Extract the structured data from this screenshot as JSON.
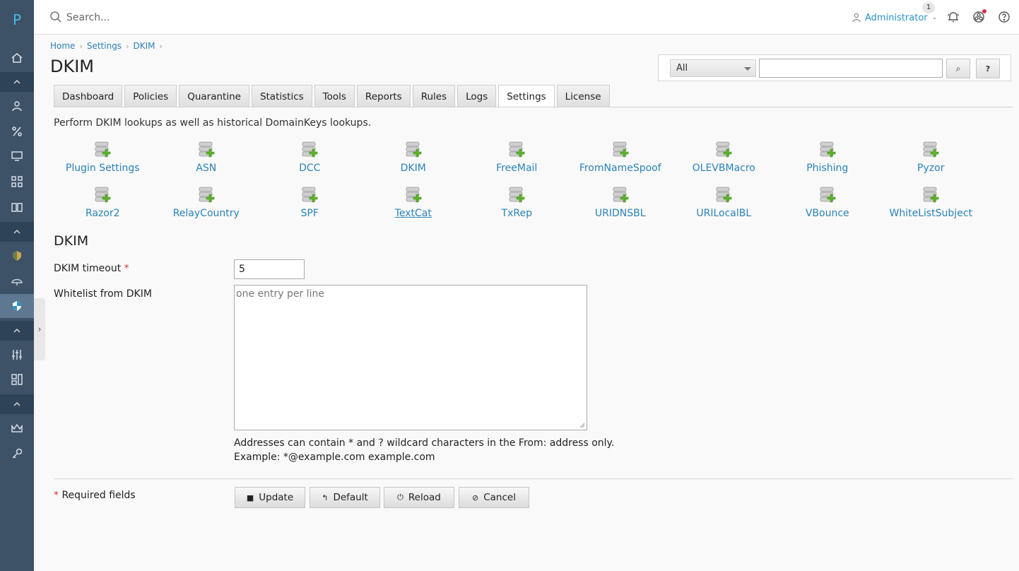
{
  "rail": {
    "logo": "P"
  },
  "topbar": {
    "search_placeholder": "Search...",
    "user_label": "Administrator",
    "notification_count": "1"
  },
  "breadcrumb": [
    "Home",
    "Settings",
    "DKIM"
  ],
  "page_title": "DKIM",
  "filter": {
    "select_value": "All",
    "search_icon_label": "⌕",
    "help_label": "?"
  },
  "tabs": [
    "Dashboard",
    "Policies",
    "Quarantine",
    "Statistics",
    "Tools",
    "Reports",
    "Rules",
    "Logs",
    "Settings",
    "License"
  ],
  "active_tab": "Settings",
  "description": "Perform DKIM lookups as well as historical DomainKeys lookups.",
  "plugins": [
    "Plugin Settings",
    "ASN",
    "DCC",
    "DKIM",
    "FreeMail",
    "FromNameSpoof",
    "OLEVBMacro",
    "Phishing",
    "Pyzor",
    "Razor2",
    "RelayCountry",
    "SPF",
    "TextCat",
    "TxRep",
    "URIDNSBL",
    "URILocalBL",
    "VBounce",
    "WhiteListSubject"
  ],
  "form": {
    "section_title": "DKIM",
    "timeout_label": "DKIM timeout",
    "required_mark": "*",
    "timeout_value": "5",
    "whitelist_label": "Whitelist from DKIM",
    "whitelist_placeholder": "one entry per line",
    "hint_line1": "Addresses can contain * and ? wildcard characters in the From: address only.",
    "hint_line2": "Example: *@example.com example.com",
    "required_note": "Required fields"
  },
  "buttons": {
    "update": "Update",
    "default": "Default",
    "reload": "Reload",
    "cancel": "Cancel"
  },
  "colors": {
    "rail": "#3d5167",
    "link": "#2a83b8",
    "required": "#d43f3a"
  }
}
